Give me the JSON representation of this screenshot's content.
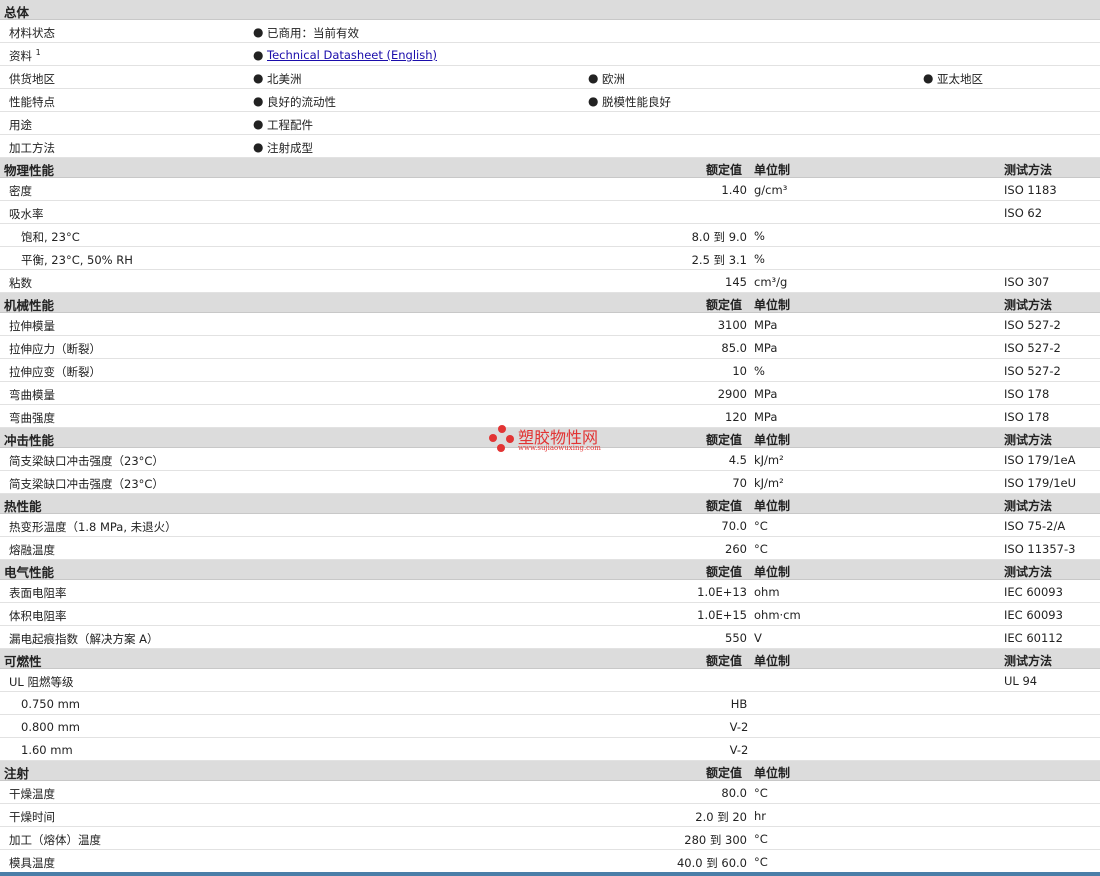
{
  "general": {
    "title": "总体",
    "material_status_label": "材料状态",
    "material_status_value": "已商用：当前有效",
    "docs_label": "资料",
    "docs_sup": "1",
    "docs_link": "Technical Datasheet (English)",
    "supply_label": "供货地区",
    "supply": [
      "北美洲",
      "欧洲",
      "亚太地区"
    ],
    "features_label": "性能特点",
    "features": [
      "良好的流动性",
      "脱模性能良好"
    ],
    "uses_label": "用途",
    "uses": [
      "工程配件"
    ],
    "process_label": "加工方法",
    "process": [
      "注射成型"
    ]
  },
  "headers": {
    "nominal": "额定值",
    "unit": "单位制",
    "method": "测试方法"
  },
  "sections": [
    {
      "title": "物理性能",
      "has_method": true,
      "rows": [
        {
          "label": "密度",
          "value": "1.40",
          "unit": "g/cm³",
          "method": "ISO 1183"
        },
        {
          "label": "吸水率",
          "value": "",
          "unit": "",
          "method": "ISO 62"
        },
        {
          "label": "饱和, 23°C",
          "value": "8.0 到  9.0",
          "unit": "%",
          "method": "",
          "sub": true
        },
        {
          "label": "平衡, 23°C, 50% RH",
          "value": "2.5 到  3.1",
          "unit": "%",
          "method": "",
          "sub": true
        },
        {
          "label": "粘数",
          "value": "145",
          "unit": "cm³/g",
          "method": "ISO 307"
        }
      ]
    },
    {
      "title": "机械性能",
      "has_method": true,
      "rows": [
        {
          "label": "拉伸模量",
          "value": "3100",
          "unit": "MPa",
          "method": "ISO 527-2"
        },
        {
          "label": "拉伸应力（断裂）",
          "value": "85.0",
          "unit": "MPa",
          "method": "ISO 527-2"
        },
        {
          "label": "拉伸应变（断裂）",
          "value": "10",
          "unit": "%",
          "method": "ISO 527-2"
        },
        {
          "label": "弯曲模量",
          "value": "2900",
          "unit": "MPa",
          "method": "ISO 178"
        },
        {
          "label": "弯曲强度",
          "value": "120",
          "unit": "MPa",
          "method": "ISO 178"
        }
      ]
    },
    {
      "title": "冲击性能",
      "has_method": true,
      "rows": [
        {
          "label": "简支梁缺口冲击强度（23°C）",
          "value": "4.5",
          "unit": "kJ/m²",
          "method": "ISO 179/1eA"
        },
        {
          "label": "简支梁缺口冲击强度（23°C）",
          "value": "70",
          "unit": "kJ/m²",
          "method": "ISO 179/1eU"
        }
      ]
    },
    {
      "title": "热性能",
      "has_method": true,
      "rows": [
        {
          "label": "热变形温度（1.8 MPa, 未退火）",
          "value": "70.0",
          "unit": "°C",
          "method": "ISO 75-2/A"
        },
        {
          "label": "熔融温度",
          "value": "260",
          "unit": "°C",
          "method": "ISO 11357-3"
        }
      ]
    },
    {
      "title": "电气性能",
      "has_method": true,
      "rows": [
        {
          "label": "表面电阻率",
          "value": "1.0E+13",
          "unit": "ohm",
          "method": "IEC 60093"
        },
        {
          "label": "体积电阻率",
          "value": "1.0E+15",
          "unit": "ohm·cm",
          "method": "IEC 60093"
        },
        {
          "label": "漏电起痕指数（解决方案 A）",
          "value": "550",
          "unit": "V",
          "method": "IEC 60112"
        }
      ]
    },
    {
      "title": "可燃性",
      "has_method": true,
      "rows": [
        {
          "label": "UL 阻燃等级",
          "value": "",
          "unit": "",
          "method": "UL 94"
        },
        {
          "label": "0.750 mm",
          "value": "HB",
          "unit": "",
          "method": "",
          "sub": true,
          "center": true
        },
        {
          "label": "0.800 mm",
          "value": "V-2",
          "unit": "",
          "method": "",
          "sub": true,
          "center": true
        },
        {
          "label": "1.60 mm",
          "value": "V-2",
          "unit": "",
          "method": "",
          "sub": true,
          "center": true
        }
      ]
    },
    {
      "title": "注射",
      "has_method": false,
      "rows": [
        {
          "label": "干燥温度",
          "value": "80.0",
          "unit": "°C",
          "method": ""
        },
        {
          "label": "干燥时间",
          "value": "2.0 到  20",
          "unit": "hr",
          "method": ""
        },
        {
          "label": "加工（熔体）温度",
          "value": "280 到  300",
          "unit": "°C",
          "method": ""
        },
        {
          "label": "模具温度",
          "value": "40.0 到  60.0",
          "unit": "°C",
          "method": ""
        }
      ]
    }
  ],
  "watermark": {
    "name": "塑胶物性网",
    "url": "www.sujiaowuxing.com"
  }
}
